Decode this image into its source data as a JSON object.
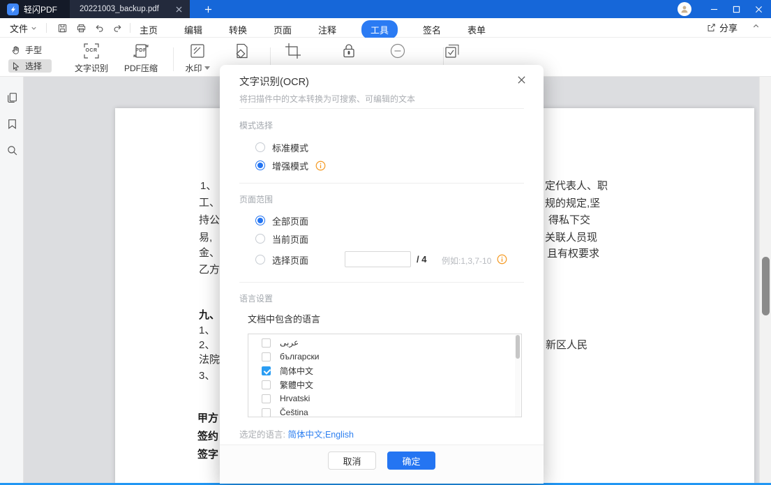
{
  "titlebar": {
    "app_name": "轻闪PDF",
    "tab_title": "20221003_backup.pdf"
  },
  "menubar": {
    "file_label": "文件",
    "tabs": [
      "主页",
      "编辑",
      "转换",
      "页面",
      "注释",
      "工具",
      "签名",
      "表单"
    ],
    "active_tab": "工具",
    "share_label": "分享"
  },
  "toolbar": {
    "hand_label": "手型",
    "select_label": "选择",
    "ocr_label": "文字识别",
    "ocr_icon_text": "OCR",
    "compress_label": "PDF压缩",
    "pdf_icon_text": "PDF",
    "watermark_label": "水印"
  },
  "dialog": {
    "title": "文字识别(OCR)",
    "subtitle": "将扫描件中的文本转换为可搜索、可编辑的文本",
    "mode_section": {
      "label": "模式选择",
      "options": [
        {
          "label": "标准模式",
          "checked": false
        },
        {
          "label": "增强模式",
          "checked": true
        }
      ]
    },
    "range_section": {
      "label": "页面范围",
      "options": [
        {
          "label": "全部页面",
          "checked": true
        },
        {
          "label": "当前页面",
          "checked": false
        },
        {
          "label": "选择页面",
          "checked": false
        }
      ],
      "page_input_value": "",
      "total_pages": "/ 4",
      "hint": "例如:1,3,7-10"
    },
    "language_section": {
      "label": "语言设置",
      "sub_label": "文档中包含的语言",
      "languages": [
        {
          "label": "عربى",
          "checked": false
        },
        {
          "label": "български",
          "checked": false
        },
        {
          "label": "简体中文",
          "checked": true
        },
        {
          "label": "繁體中文",
          "checked": false
        },
        {
          "label": "Hrvatski",
          "checked": false
        },
        {
          "label": "Čeština",
          "checked": false
        }
      ],
      "selected_label": "选定的语言:",
      "selected_value": "简体中文;English"
    },
    "cancel_label": "取消",
    "confirm_label": "确定"
  },
  "document": {
    "left_fragments": [
      "1、",
      "工、",
      "持公",
      "易,",
      "金、",
      "乙方",
      "九、",
      "1、",
      "2、",
      "法院",
      "3、",
      "甲方",
      "签约",
      "签字"
    ],
    "right_fragments": [
      "定代表人、职",
      "规的规定,坚",
      "得私下交",
      "关联人员现",
      "且有权要求",
      "新区人民"
    ]
  },
  "colors": {
    "accent": "#2475f2",
    "titlebar_blue": "#1667d9",
    "titlebar_dark": "#141a28",
    "bottom_line": "#2196f3",
    "checkbox_blue": "#2b9df3"
  }
}
